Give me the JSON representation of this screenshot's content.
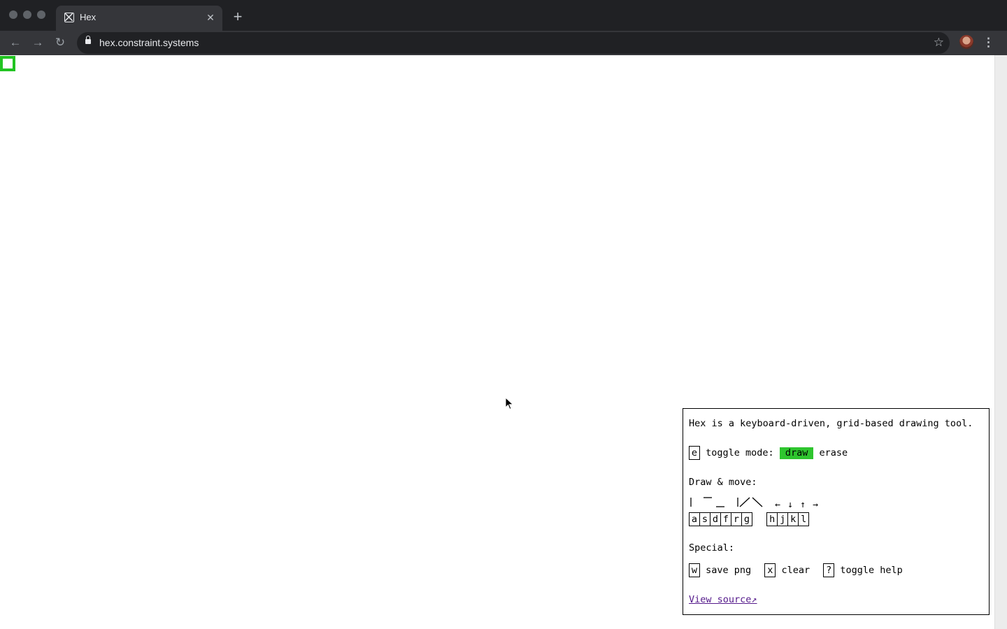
{
  "browser": {
    "tab_title": "Hex",
    "tab_close": "✕",
    "new_tab": "+",
    "url": "hex.constraint.systems",
    "back": "←",
    "forward": "→",
    "reload": "↻",
    "bookmark": "☆",
    "menu": "⋮"
  },
  "help": {
    "intro": "Hex is a keyboard-driven, grid-based drawing tool.",
    "toggle_key": "e",
    "toggle_label": "toggle mode:",
    "mode_draw": "draw",
    "mode_erase": "erase",
    "draw_move_heading": "Draw & move:",
    "draw_keys": [
      "a",
      "s",
      "d",
      "f",
      "r",
      "g"
    ],
    "move_arrows": [
      "←",
      "↓",
      "↑",
      "→"
    ],
    "move_keys": [
      "h",
      "j",
      "k",
      "l"
    ],
    "special_heading": "Special:",
    "special": [
      {
        "key": "w",
        "label": "save png"
      },
      {
        "key": "x",
        "label": "clear"
      },
      {
        "key": "?",
        "label": "toggle help"
      }
    ],
    "view_source": "View source↗"
  },
  "colors": {
    "accent": "#22c422",
    "mode_highlight": "#2ec52e",
    "link": "#551a8b"
  }
}
